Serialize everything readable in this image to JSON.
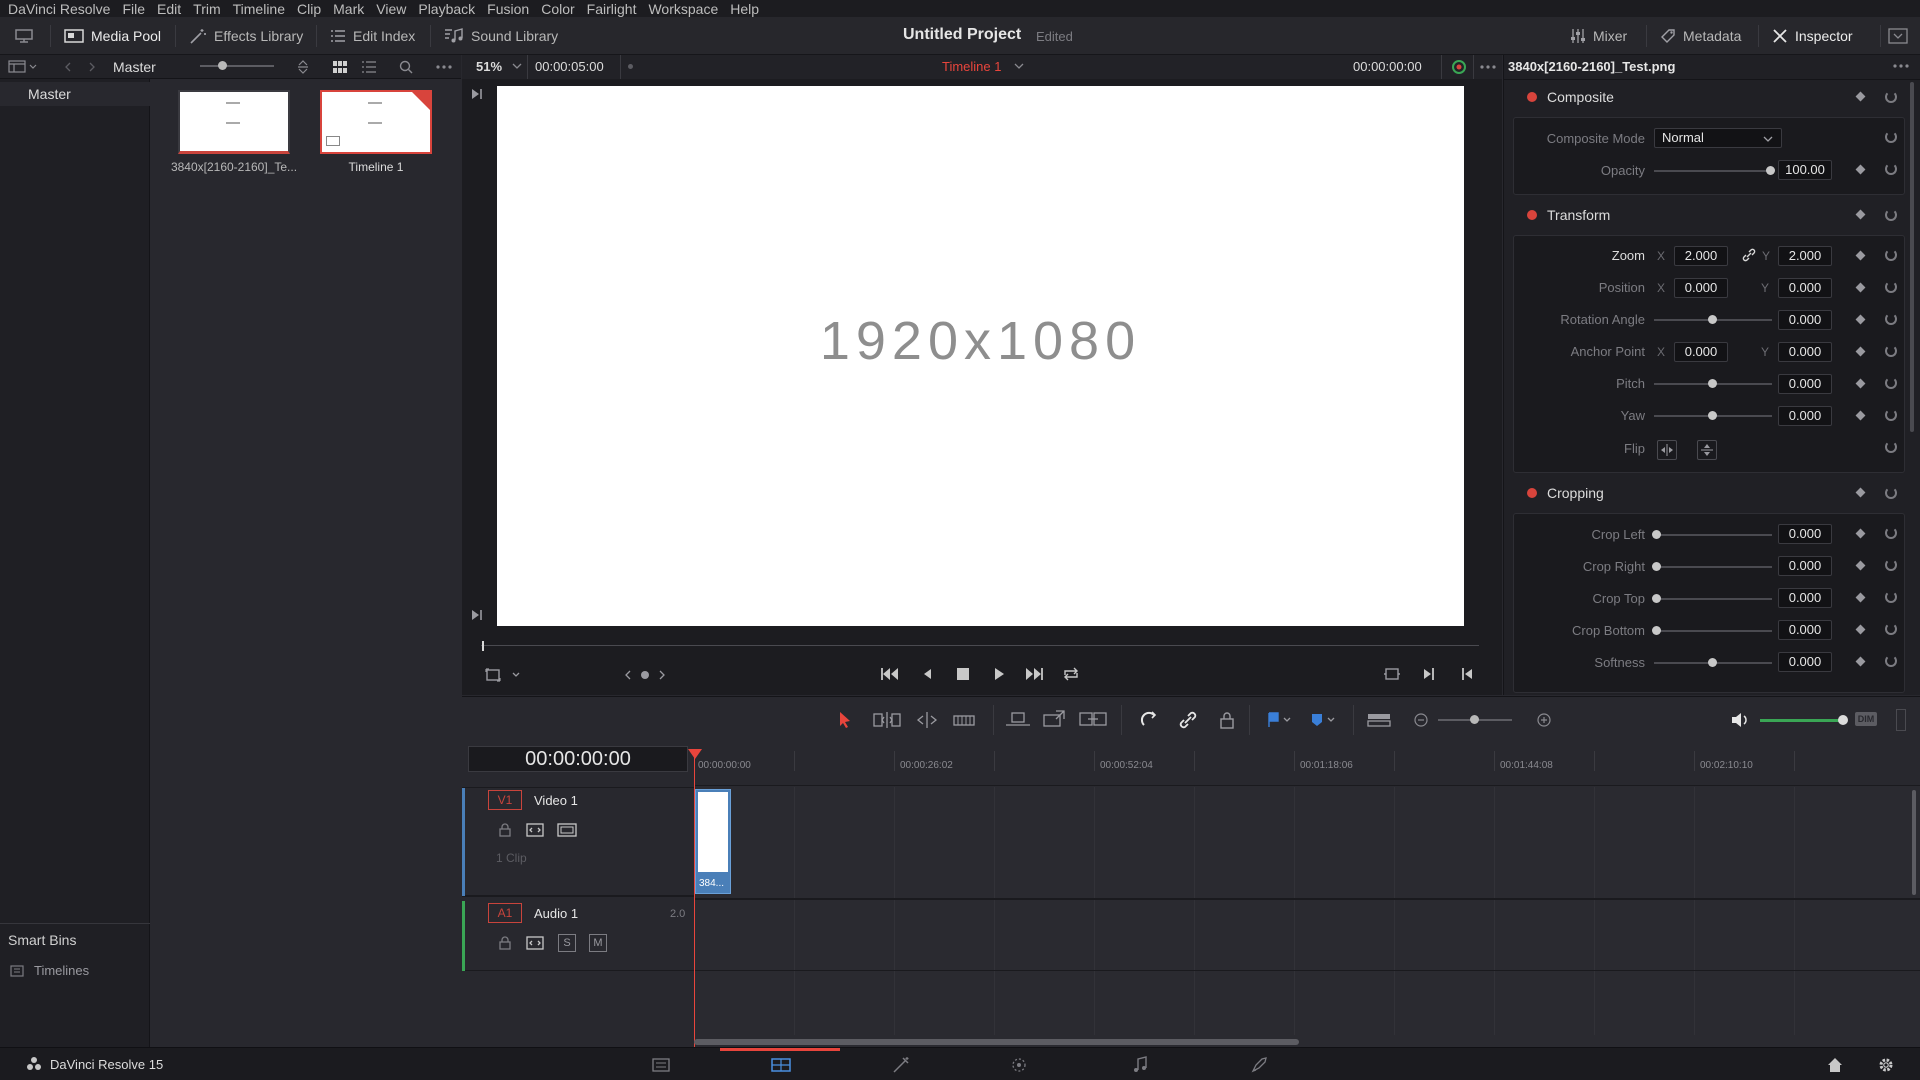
{
  "menu": [
    "DaVinci Resolve",
    "File",
    "Edit",
    "Trim",
    "Timeline",
    "Clip",
    "Mark",
    "View",
    "Playback",
    "Fusion",
    "Color",
    "Fairlight",
    "Workspace",
    "Help"
  ],
  "toolbar": {
    "media_pool": "Media Pool",
    "effects_library": "Effects Library",
    "edit_index": "Edit Index",
    "sound_library": "Sound Library",
    "project_title": "Untitled Project",
    "project_status": "Edited",
    "mixer": "Mixer",
    "metadata": "Metadata",
    "inspector": "Inspector"
  },
  "pool": {
    "bin_name": "Master",
    "tree_root": "Master",
    "smart_bins": "Smart Bins",
    "timelines": "Timelines",
    "clips": [
      {
        "name": "3840x[2160-2160]_Te...",
        "selected": false
      },
      {
        "name": "Timeline 1",
        "selected": true
      }
    ]
  },
  "viewer": {
    "zoom": "51%",
    "duration": "00:00:05:00",
    "timeline_name": "Timeline 1",
    "timecode": "00:00:00:00",
    "frame_text": "1920x1080"
  },
  "inspector": {
    "clip_name": "3840x[2160-2160]_Test.png",
    "composite": {
      "title": "Composite",
      "mode_label": "Composite Mode",
      "mode_value": "Normal",
      "opacity_label": "Opacity",
      "opacity_value": "100.00"
    },
    "transform": {
      "title": "Transform",
      "zoom_label": "Zoom",
      "zoom_x": "2.000",
      "zoom_y": "2.000",
      "position_label": "Position",
      "position_x": "0.000",
      "position_y": "0.000",
      "rotation_label": "Rotation Angle",
      "rotation_value": "0.000",
      "anchor_label": "Anchor Point",
      "anchor_x": "0.000",
      "anchor_y": "0.000",
      "pitch_label": "Pitch",
      "pitch_value": "0.000",
      "yaw_label": "Yaw",
      "yaw_value": "0.000",
      "flip_label": "Flip",
      "x_axis": "X",
      "y_axis": "Y"
    },
    "cropping": {
      "title": "Cropping",
      "crop_left_label": "Crop Left",
      "crop_left": "0.000",
      "crop_right_label": "Crop Right",
      "crop_right": "0.000",
      "crop_top_label": "Crop Top",
      "crop_top": "0.000",
      "crop_bottom_label": "Crop Bottom",
      "crop_bottom": "0.000",
      "softness_label": "Softness",
      "softness": "0.000"
    }
  },
  "timeline": {
    "timecode": "00:00:00:00",
    "ruler": [
      "00:00:00:00",
      "00:00:26:02",
      "00:00:52:04",
      "00:01:18:06",
      "00:01:44:08",
      "00:02:10:10"
    ],
    "video_track": {
      "id": "V1",
      "name": "Video 1",
      "clip_count": "1 Clip",
      "clip_label": "384..."
    },
    "audio_track": {
      "id": "A1",
      "name": "Audio 1",
      "channels": "2.0",
      "solo": "S",
      "mute": "M"
    },
    "dim": "DIM"
  },
  "status": {
    "app_version": "DaVinci Resolve 15"
  },
  "colors": {
    "accent_red": "#d8443c",
    "playhead": "#e8453c",
    "selection_blue": "#4a7fb8"
  }
}
